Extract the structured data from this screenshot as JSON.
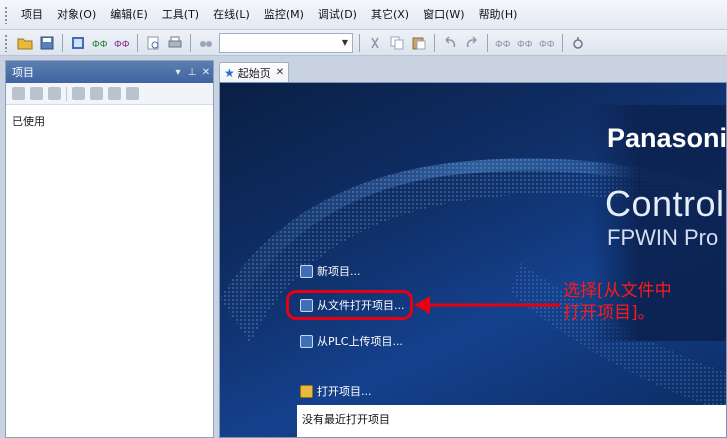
{
  "menubar": {
    "items": [
      {
        "key": "project",
        "label": "项目"
      },
      {
        "key": "object",
        "label": "对象(O)"
      },
      {
        "key": "edit",
        "label": "编辑(E)"
      },
      {
        "key": "tools",
        "label": "工具(T)"
      },
      {
        "key": "online",
        "label": "在线(L)"
      },
      {
        "key": "monitor",
        "label": "监控(M)"
      },
      {
        "key": "debug",
        "label": "调试(D)"
      },
      {
        "key": "other",
        "label": "其它(X)"
      },
      {
        "key": "window",
        "label": "窗口(W)"
      },
      {
        "key": "help",
        "label": "帮助(H)"
      }
    ]
  },
  "toolbar": {
    "combo_value": "",
    "icons": [
      "open-folder-icon",
      "save-icon",
      "build-icon",
      "compile-icon",
      "compile-all-icon",
      "print-preview-icon",
      "print-icon",
      "find-icon",
      "cut-icon",
      "copy-icon",
      "paste-icon",
      "undo-icon",
      "redo-icon",
      "online-icon",
      "offline-icon",
      "monitor-icon",
      "debug-icon"
    ]
  },
  "project_panel": {
    "title": "项目",
    "pin_label": "▾ ⊥ ✕",
    "items": [
      "已使用"
    ]
  },
  "document": {
    "tab_label": "起始页",
    "brand_name": "Panasonic",
    "product_line1": "Control",
    "product_line2": "FPWIN Pro",
    "links": {
      "new_project": "新项目...",
      "open_from_file": "从文件打开项目...",
      "upload_from_plc": "从PLC上传项目...",
      "open_project": "打开项目..."
    },
    "recent_empty_text": "没有最近打开项目"
  },
  "annotation": {
    "line1": "选择[从文件中",
    "line2": "打开项目]。",
    "color": "#e60012"
  },
  "colors": {
    "panel_header": "#4a6da8",
    "doc_background": "#10306a",
    "highlight": "#e60012"
  }
}
